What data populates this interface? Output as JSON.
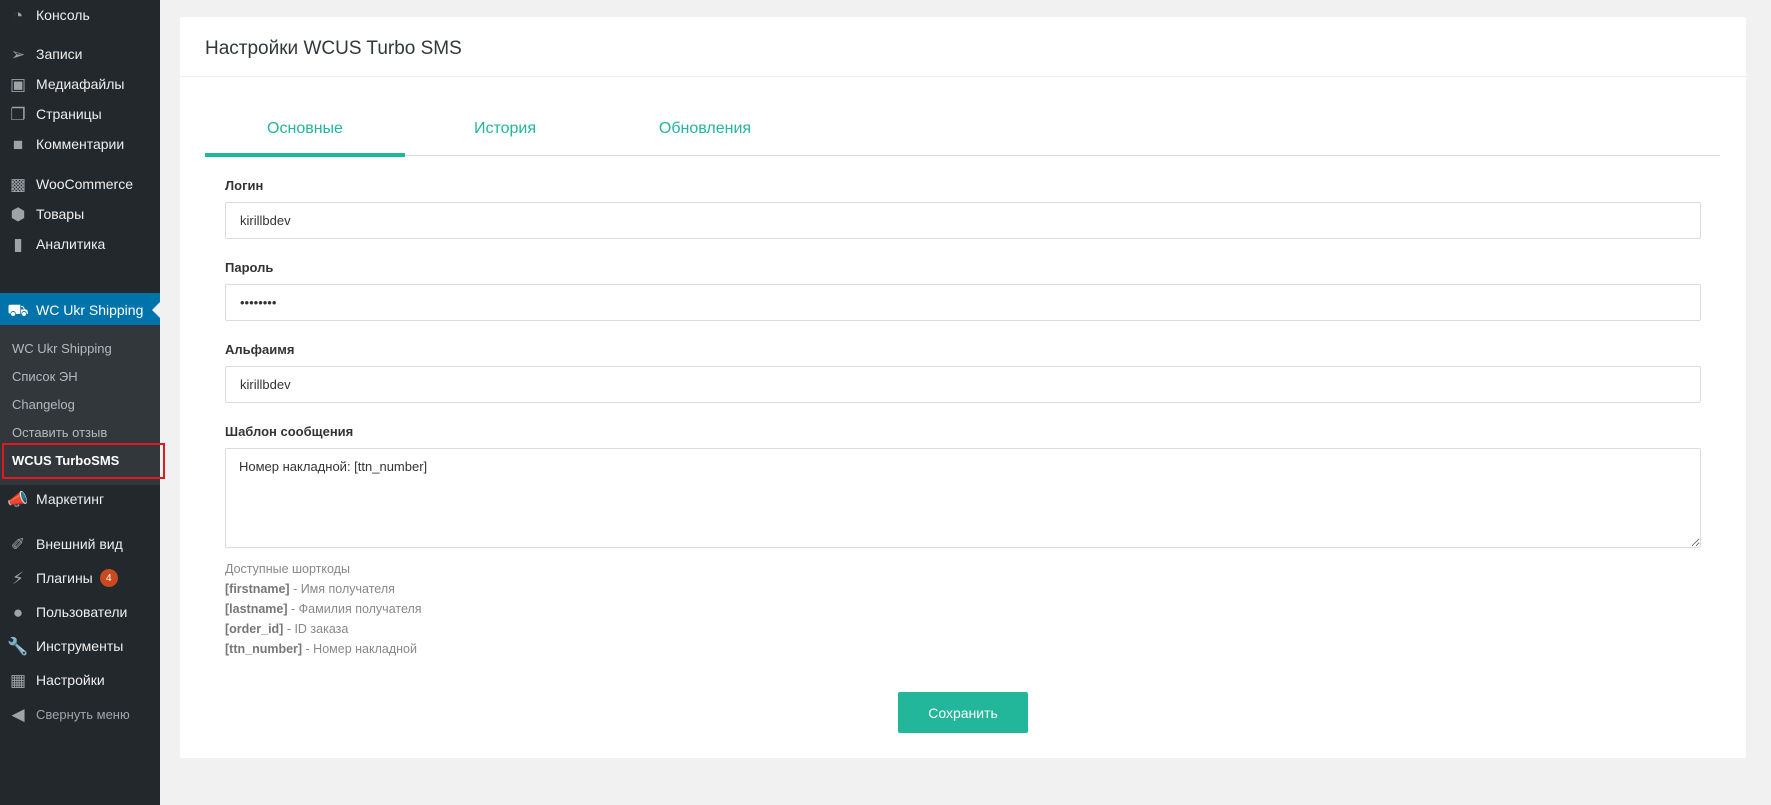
{
  "sidebar": {
    "items": [
      {
        "label": "Консоль",
        "icon": "dashboard-icon"
      },
      {
        "label": "Записи",
        "icon": "pin-icon"
      },
      {
        "label": "Медиафайлы",
        "icon": "media-icon"
      },
      {
        "label": "Страницы",
        "icon": "pages-icon"
      },
      {
        "label": "Комментарии",
        "icon": "comment-icon"
      },
      {
        "label": "WooCommerce",
        "icon": "woo-icon"
      },
      {
        "label": "Товары",
        "icon": "box-icon"
      },
      {
        "label": "Аналитика",
        "icon": "chart-icon"
      },
      {
        "label": "WC Ukr Shipping",
        "icon": "truck-icon"
      },
      {
        "label": "Маркетинг",
        "icon": "megaphone-icon"
      },
      {
        "label": "Внешний вид",
        "icon": "brush-icon"
      },
      {
        "label": "Плагины",
        "icon": "plug-icon",
        "badge": "4"
      },
      {
        "label": "Пользователи",
        "icon": "user-icon"
      },
      {
        "label": "Инструменты",
        "icon": "wrench-icon"
      },
      {
        "label": "Настройки",
        "icon": "settings-icon"
      },
      {
        "label": "Свернуть меню",
        "icon": "collapse-icon"
      }
    ],
    "submenu": [
      {
        "label": "WC Ukr Shipping"
      },
      {
        "label": "Список ЭН"
      },
      {
        "label": "Changelog"
      },
      {
        "label": "Оставить отзыв"
      },
      {
        "label": "WCUS TurboSMS"
      }
    ]
  },
  "card": {
    "title": "Настройки WCUS Turbo SMS",
    "tabs": [
      {
        "label": "Основные"
      },
      {
        "label": "История"
      },
      {
        "label": "Обновления"
      }
    ],
    "login": {
      "label": "Логин",
      "value": "kirillbdev"
    },
    "password": {
      "label": "Пароль",
      "value": "••••••••"
    },
    "alphaname": {
      "label": "Альфаимя",
      "value": "kirillbdev"
    },
    "template": {
      "label": "Шаблон сообщения",
      "value": "Номер накладной: [ttn_number]"
    },
    "shortcodes": {
      "title": "Доступные шорткоды",
      "items": [
        {
          "code": "[firstname]",
          "desc": " - Имя получателя"
        },
        {
          "code": "[lastname]",
          "desc": " - Фамилия получателя"
        },
        {
          "code": "[order_id]",
          "desc": " - ID заказа"
        },
        {
          "code": "[ttn_number]",
          "desc": " - Номер накладной"
        }
      ]
    },
    "save_label": "Сохранить"
  },
  "colors": {
    "accent": "#22b69a",
    "sidebar_bg": "#23282d",
    "sidebar_active": "#0073aa",
    "highlight": "#e0191e",
    "badge": "#ca4a1f"
  }
}
